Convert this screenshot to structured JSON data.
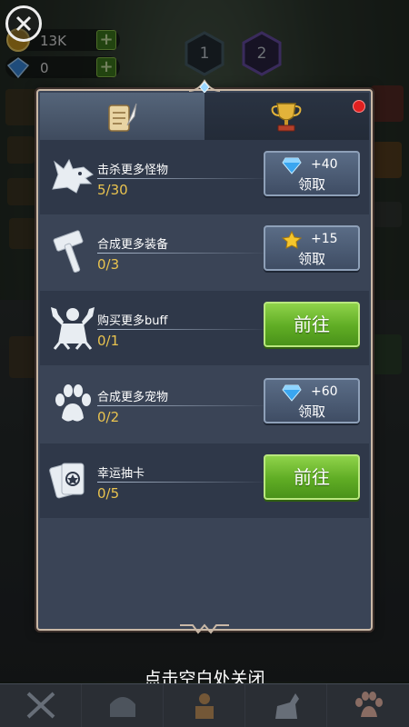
{
  "background": {
    "gold_value": "13K",
    "gem_value": "0",
    "stage_current": "1",
    "stage_next": "2"
  },
  "tabs": [
    {
      "icon": "scroll-quill-icon",
      "active": true
    },
    {
      "icon": "trophy-icon",
      "active": false,
      "has_notification": true
    }
  ],
  "tasks": [
    {
      "title": "击杀更多怪物",
      "progress": "5/30",
      "icon": "wolf-icon",
      "action": "claim",
      "reward_icon": "diamond-icon",
      "reward_amount": "+40",
      "button_label": "领取"
    },
    {
      "title": "合成更多装备",
      "progress": "0/3",
      "icon": "hammer-icon",
      "action": "claim",
      "reward_icon": "star-icon",
      "reward_amount": "+15",
      "button_label": "领取"
    },
    {
      "title": "购买更多buff",
      "progress": "0/1",
      "icon": "muscle-buff-icon",
      "action": "go",
      "button_label": "前往"
    },
    {
      "title": "合成更多宠物",
      "progress": "0/2",
      "icon": "paw-icon",
      "action": "claim",
      "reward_icon": "diamond-icon",
      "reward_amount": "+60",
      "button_label": "领取"
    },
    {
      "title": "幸运抽卡",
      "progress": "0/5",
      "icon": "cards-icon",
      "action": "go",
      "button_label": "前往"
    }
  ],
  "hint_text": "点击空白处关闭",
  "bottom_nav": [
    "swords-icon",
    "helmet-icon",
    "buff-icon",
    "horse-icon",
    "paw-icon"
  ],
  "colors": {
    "panel": "#3a4456",
    "progress_text": "#e9c34f",
    "go_button": "#5fac24",
    "claim_button": "#4f5f78"
  }
}
